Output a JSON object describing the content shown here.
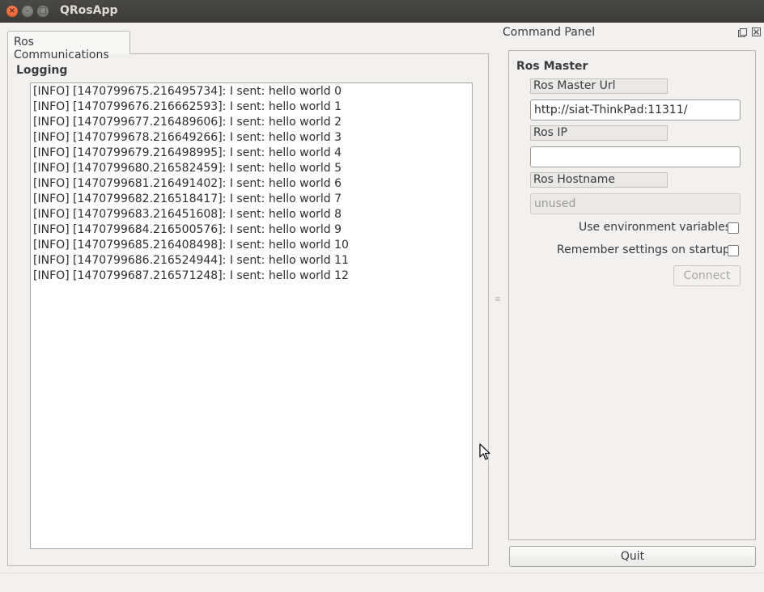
{
  "window": {
    "title": "QRosApp",
    "close_glyph": "×",
    "min_glyph": "–",
    "max_glyph": "□"
  },
  "tabs": [
    {
      "label": "Ros Communications"
    }
  ],
  "logging": {
    "label": "Logging",
    "lines": [
      "[INFO] [1470799675.216495734]: I sent: hello world 0",
      "[INFO] [1470799676.216662593]: I sent: hello world 1",
      "[INFO] [1470799677.216489606]: I sent: hello world 2",
      "[INFO] [1470799678.216649266]: I sent: hello world 3",
      "[INFO] [1470799679.216498995]: I sent: hello world 4",
      "[INFO] [1470799680.216582459]: I sent: hello world 5",
      "[INFO] [1470799681.216491402]: I sent: hello world 6",
      "[INFO] [1470799682.216518417]: I sent: hello world 7",
      "[INFO] [1470799683.216451608]: I sent: hello world 8",
      "[INFO] [1470799684.216500576]: I sent: hello world 9",
      "[INFO] [1470799685.216408498]: I sent: hello world 10",
      "[INFO] [1470799686.216524944]: I sent: hello world 11",
      "[INFO] [1470799687.216571248]: I sent: hello world 12"
    ]
  },
  "dock": {
    "title": "Command Panel",
    "float_glyph": "⧉",
    "close_glyph": "☒",
    "group_label": "Ros Master",
    "master_url": {
      "label": "Ros Master Url",
      "value": "http://siat-ThinkPad:11311/"
    },
    "ros_ip": {
      "label": "Ros IP",
      "value": ""
    },
    "ros_hostname": {
      "label": "Ros Hostname",
      "value": "unused"
    },
    "use_env_label": "Use environment variables",
    "use_env_checked": false,
    "remember_label": "Remember settings on startup",
    "remember_checked": false,
    "connect_label": "Connect",
    "connect_enabled": false
  },
  "quit_label": "Quit",
  "colors": {
    "titlebar": "#3b3a37",
    "close_button": "#e2541f",
    "background": "#f2f1f0"
  }
}
